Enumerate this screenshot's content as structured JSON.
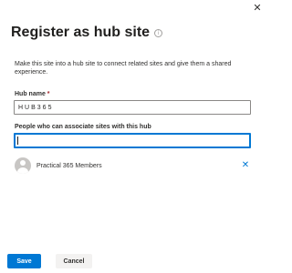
{
  "panel": {
    "close_icon": "close-icon",
    "title": "Register as hub site",
    "info_icon": "info-icon",
    "description": "Make this site into a hub site to connect related sites and give them a shared experience."
  },
  "hub_name": {
    "label": "Hub name",
    "required_marker": "*",
    "value": "HUB365"
  },
  "people": {
    "label": "People who can associate sites with this hub",
    "value": "",
    "selected": [
      {
        "name": "Practical 365 Members",
        "avatar_icon": "person-icon",
        "remove_icon": "close-icon"
      }
    ]
  },
  "footer": {
    "save_label": "Save",
    "cancel_label": "Cancel"
  },
  "colors": {
    "accent": "#0078d4",
    "required": "#a4262c",
    "avatar_bg": "#c8c6c4"
  }
}
